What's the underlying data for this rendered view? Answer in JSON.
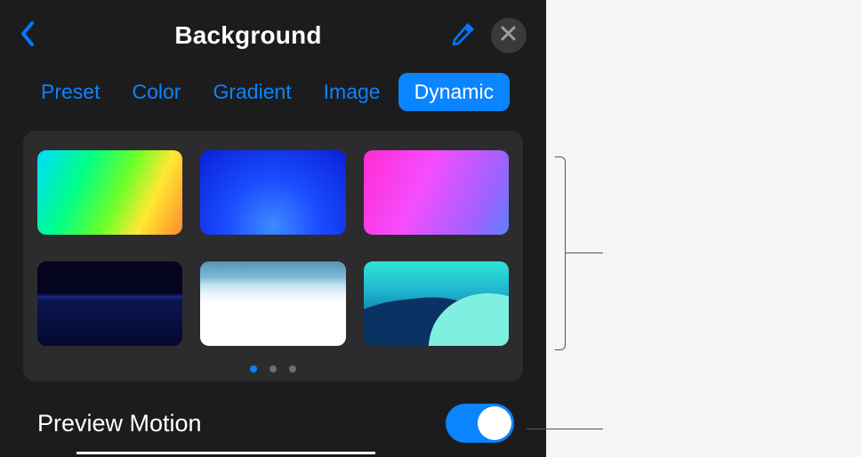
{
  "header": {
    "title": "Background"
  },
  "tabs": {
    "items": [
      {
        "label": "Preset",
        "active": false
      },
      {
        "label": "Color",
        "active": false
      },
      {
        "label": "Gradient",
        "active": false
      },
      {
        "label": "Image",
        "active": false
      },
      {
        "label": "Dynamic",
        "active": true
      }
    ]
  },
  "palette": {
    "thumbnails": [
      "rainbow-gradient",
      "deep-blue",
      "pink-purple",
      "dark-wave",
      "white-sky",
      "teal-landscape"
    ],
    "page_count": 3,
    "active_page": 0
  },
  "preview_motion": {
    "label": "Preview Motion",
    "on": true
  },
  "icons": {
    "back": "chevron-left-icon",
    "eyedropper": "eyedropper-icon",
    "close": "close-icon"
  },
  "colors": {
    "accent": "#0a84ff",
    "panel": "#1c1c1e",
    "card": "#2c2c2e"
  }
}
